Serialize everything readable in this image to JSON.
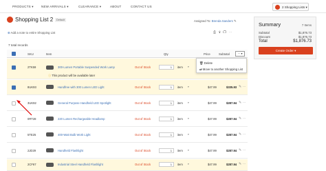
{
  "nav": {
    "products": "PRODUCTS ▾",
    "new_arrivals": "NEW ARRIVALS ▾",
    "clearance": "CLEARANCE ▾",
    "about": "ABOUT",
    "contact": "CONTACT US",
    "cart_label": "2 Shopping Lists ▾"
  },
  "header": {
    "title": "Shopping List 2",
    "badge": "Default",
    "assigned_prefix": "Assigned To:",
    "assigned_name": "Brenda Sanders",
    "add_note": "Add a note to entire Shopping List",
    "records": "7 total records"
  },
  "columns": {
    "sku": "SKU",
    "item": "Item",
    "qty": "Qty",
    "price": "Price",
    "subtotal": "Subtotal"
  },
  "dropdown": {
    "caret_label": "⋯ ▾",
    "delete": "Delete",
    "move": "Move to another Shopping List"
  },
  "rows": [
    {
      "sku": "2TK59",
      "item": "300-Lumen Portable Suspended Work Lamp",
      "status": "Out of Stock",
      "qty": "1",
      "uom": "item",
      "price": "",
      "subtotal": "",
      "note": "This product will be available later"
    },
    {
      "sku": "8UK93",
      "item": "Handfree with 300 Lumen LED Light",
      "status": "Out of Stock",
      "qty": "1",
      "uom": "item",
      "price": "$47.99",
      "subtotal": "$335.93"
    },
    {
      "sku": "3UK92",
      "item": "General Purpose Handheld LED Spotlight",
      "status": "Out of Stock",
      "qty": "1",
      "uom": "item",
      "price": "$47.99",
      "subtotal": "$287.94"
    },
    {
      "sku": "0RT28",
      "item": "220 Lumen Rechargeable Headlamp",
      "status": "Out of Stock",
      "qty": "1",
      "uom": "item",
      "price": "$47.99",
      "subtotal": "$287.94"
    },
    {
      "sku": "5TE25",
      "item": "400-Watt Bulb Work Light",
      "status": "Out of Stock",
      "qty": "1",
      "uom": "item",
      "price": "$47.99",
      "subtotal": "$287.94"
    },
    {
      "sku": "2JD29",
      "item": "Handheld Flashlight",
      "status": "Out of Stock",
      "qty": "1",
      "uom": "item",
      "price": "$47.99",
      "subtotal": "$287.94"
    },
    {
      "sku": "2CF67",
      "item": "Industrial Steel Handheld Flashlight",
      "status": "Out of Stock",
      "qty": "1",
      "uom": "item",
      "price": "$47.99",
      "subtotal": "$287.94"
    }
  ],
  "summary": {
    "title": "Summary",
    "items": "7 Items",
    "subtotal_label": "Subtotal",
    "subtotal_value": "$1,876.73",
    "discount_label": "Discount",
    "discount_value": "$1,876.73",
    "total_label": "Total",
    "total_value": "$1,876.73",
    "create_order": "Create Order ▾"
  },
  "colors": {
    "accent": "#d9411e",
    "link": "#3b6fb5",
    "highlight_row": "#fff8dd"
  }
}
